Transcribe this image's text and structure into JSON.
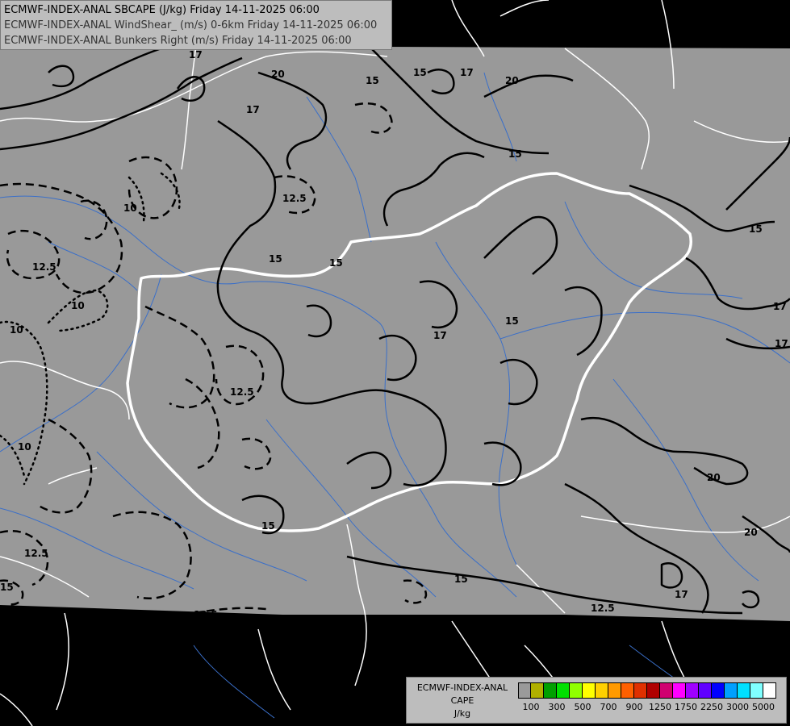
{
  "header": {
    "lines": [
      "ECMWF-INDEX-ANAL SBCAPE (J/kg) Friday 14-11-2025 06:00",
      "ECMWF-INDEX-ANAL WindShear_ (m/s) 0-6km Friday 14-11-2025 06:00",
      "ECMWF-INDEX-ANAL Bunkers Right (m/s) Friday 14-11-2025 06:00"
    ]
  },
  "legend": {
    "caption_lines": [
      "ECMWF-INDEX-ANAL",
      "CAPE",
      "J/kg"
    ],
    "colors": [
      "#9a9a9a",
      "#b0b000",
      "#00a000",
      "#00e000",
      "#90ff00",
      "#ffff00",
      "#ffd000",
      "#ff9a00",
      "#ff6000",
      "#e03000",
      "#b00000",
      "#d00070",
      "#ff00ff",
      "#a000ff",
      "#6000ff",
      "#0000ff",
      "#00a0ff",
      "#00e0ff",
      "#80ffff",
      "#ffffff"
    ],
    "tick_labels": [
      "100",
      "300",
      "500",
      "700",
      "900",
      "1250",
      "1750",
      "2250",
      "3000",
      "5000"
    ]
  },
  "map": {
    "background": "#000000",
    "domain_fill": "#999999",
    "contour_labels_solid": [
      "17",
      "20",
      "15",
      "17",
      "15",
      "15",
      "17",
      "15",
      "15",
      "20",
      "17",
      "20",
      "15",
      "17",
      "15",
      "20",
      "15",
      "17",
      "17",
      "15",
      "12.5"
    ],
    "contour_labels_dashed": [
      "15",
      "12.5",
      "12.5",
      "12.5",
      "12.5",
      "12.5"
    ],
    "contour_labels_dotted": [
      "10",
      "10",
      "10",
      "10"
    ]
  },
  "colors": {
    "border_color": "#ffffff",
    "river_color": "#3a6fc9",
    "contour_color": "#000000"
  }
}
